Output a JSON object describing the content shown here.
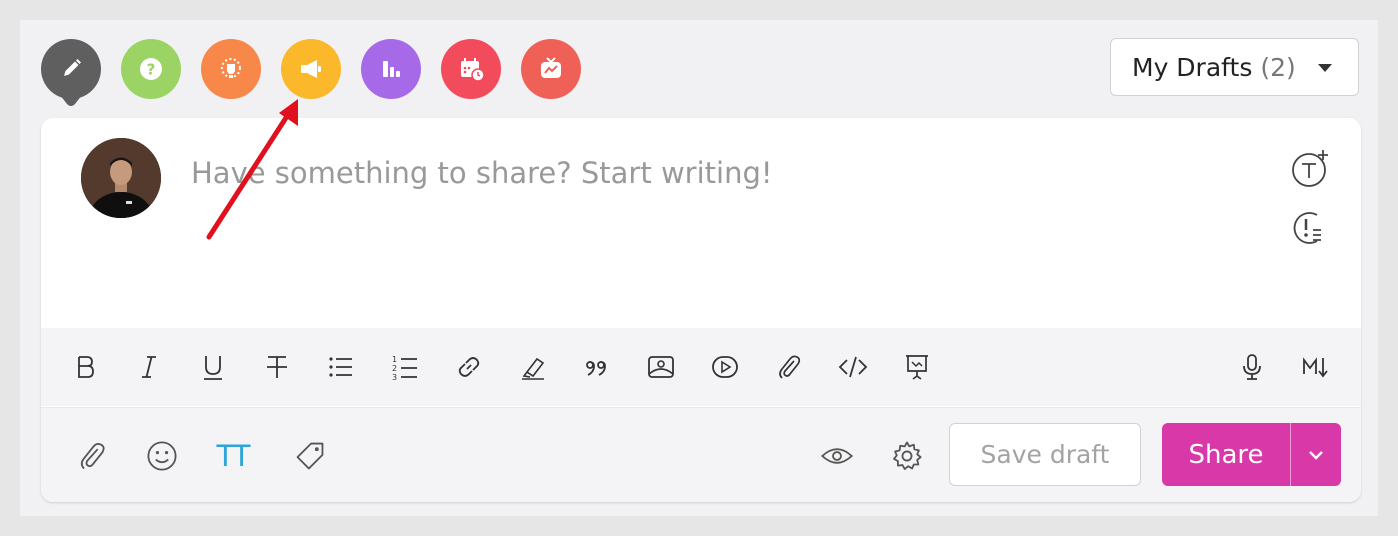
{
  "post_types": [
    {
      "name": "write-post",
      "icon": "pencil-icon",
      "color": "#5f5f5f"
    },
    {
      "name": "question",
      "icon": "question-icon",
      "color": "#9bd465"
    },
    {
      "name": "idea",
      "icon": "lightbulb-icon",
      "color": "#f8874a"
    },
    {
      "name": "announcement",
      "icon": "megaphone-icon",
      "color": "#fbb82b"
    },
    {
      "name": "poll",
      "icon": "bar-chart-icon",
      "color": "#a66ae8"
    },
    {
      "name": "event",
      "icon": "calendar-clock-icon",
      "color": "#f24b5b"
    },
    {
      "name": "live-stream",
      "icon": "tv-icon",
      "color": "#ef6157"
    }
  ],
  "drafts": {
    "label": "My Drafts",
    "count": "(2)"
  },
  "editor": {
    "placeholder": "Have something to share? Start writing!"
  },
  "footer": {
    "save_draft": "Save draft",
    "share": "Share",
    "text_size": "TT"
  },
  "colors": {
    "accent": "#d838a8",
    "highlight_arrow": "#e0101e"
  }
}
